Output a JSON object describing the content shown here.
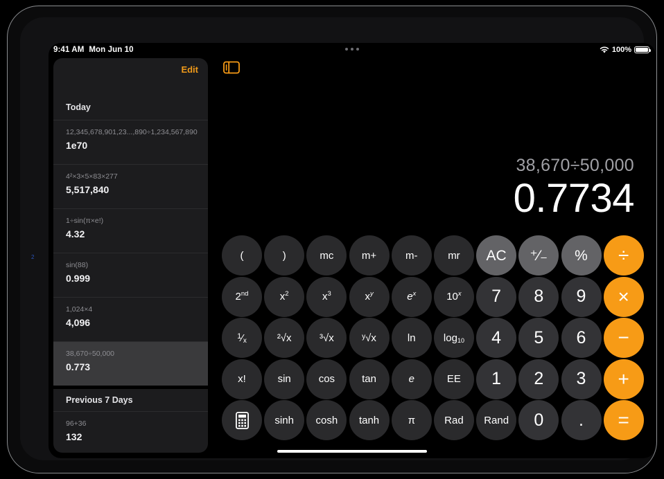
{
  "status_bar": {
    "time": "9:41 AM",
    "date": "Mon Jun 10",
    "wifi_icon": "wifi-icon",
    "battery_percent": "100%",
    "battery_icon": "battery-full-icon",
    "multitask_icon": "multitasking-dots-icon"
  },
  "sidebar": {
    "edit_label": "Edit",
    "sections": [
      {
        "title": "Today",
        "items": [
          {
            "expression": "12,345,678,901,23...,890÷1,234,567,890",
            "result": "1e70",
            "selected": false
          },
          {
            "expression": "4²×3×5×83×277",
            "result": "5,517,840",
            "selected": false
          },
          {
            "expression": "1÷sin(π×e!)",
            "result": "4.32",
            "selected": false
          },
          {
            "expression": "sin(88)",
            "result": "0.999",
            "selected": false
          },
          {
            "expression": "1,024×4",
            "result": "4,096",
            "selected": false
          },
          {
            "expression": "38,670÷50,000",
            "result": "0.773",
            "selected": true
          }
        ]
      },
      {
        "title": "Previous 7 Days",
        "items": [
          {
            "expression": "96+36",
            "result": "132",
            "selected": false
          }
        ]
      }
    ]
  },
  "main": {
    "sidebar_toggle_icon": "sidebar-toggle-icon",
    "display": {
      "expression": "38,670÷50,000",
      "result": "0.7734"
    }
  },
  "keypad": {
    "rows": [
      [
        {
          "label": "(",
          "name": "open-paren-key",
          "type": "fn"
        },
        {
          "label": ")",
          "name": "close-paren-key",
          "type": "fn"
        },
        {
          "label": "mc",
          "name": "memory-clear-key",
          "type": "fn"
        },
        {
          "label": "m+",
          "name": "memory-add-key",
          "type": "fn"
        },
        {
          "label": "m-",
          "name": "memory-subtract-key",
          "type": "fn"
        },
        {
          "label": "mr",
          "name": "memory-recall-key",
          "type": "fn"
        },
        {
          "label": "AC",
          "name": "all-clear-key",
          "type": "util"
        },
        {
          "label": "⁺⁄₋",
          "name": "plus-minus-key",
          "type": "util"
        },
        {
          "label": "%",
          "name": "percent-key",
          "type": "util"
        },
        {
          "label": "÷",
          "name": "divide-key",
          "type": "op"
        }
      ],
      [
        {
          "label": "2nd",
          "name": "second-function-key",
          "type": "fn",
          "sup": "nd",
          "base": "2"
        },
        {
          "label": "x²",
          "name": "x-squared-key",
          "type": "fn",
          "sup": "2",
          "base": "x"
        },
        {
          "label": "x³",
          "name": "x-cubed-key",
          "type": "fn",
          "sup": "3",
          "base": "x"
        },
        {
          "label": "xy",
          "name": "x-to-power-y-key",
          "type": "fn",
          "sup": "y",
          "base": "x"
        },
        {
          "label": "ex",
          "name": "e-to-power-x-key",
          "type": "fn",
          "sup": "x",
          "base": "e"
        },
        {
          "label": "10x",
          "name": "ten-to-power-x-key",
          "type": "fn",
          "sup": "x",
          "base": "10"
        },
        {
          "label": "7",
          "name": "digit-7-key",
          "type": "num"
        },
        {
          "label": "8",
          "name": "digit-8-key",
          "type": "num"
        },
        {
          "label": "9",
          "name": "digit-9-key",
          "type": "num"
        },
        {
          "label": "×",
          "name": "multiply-key",
          "type": "op"
        }
      ],
      [
        {
          "label": "1/x",
          "name": "reciprocal-key",
          "type": "fn"
        },
        {
          "label": "²√x",
          "name": "square-root-key",
          "type": "fn"
        },
        {
          "label": "³√x",
          "name": "cube-root-key",
          "type": "fn"
        },
        {
          "label": "ʸ√x",
          "name": "nth-root-key",
          "type": "fn"
        },
        {
          "label": "ln",
          "name": "natural-log-key",
          "type": "fn"
        },
        {
          "label": "log10",
          "name": "log-base-10-key",
          "type": "fn",
          "sub": "10",
          "base": "log"
        },
        {
          "label": "4",
          "name": "digit-4-key",
          "type": "num"
        },
        {
          "label": "5",
          "name": "digit-5-key",
          "type": "num"
        },
        {
          "label": "6",
          "name": "digit-6-key",
          "type": "num"
        },
        {
          "label": "−",
          "name": "subtract-key",
          "type": "op"
        }
      ],
      [
        {
          "label": "x!",
          "name": "factorial-key",
          "type": "fn"
        },
        {
          "label": "sin",
          "name": "sine-key",
          "type": "fn"
        },
        {
          "label": "cos",
          "name": "cosine-key",
          "type": "fn"
        },
        {
          "label": "tan",
          "name": "tangent-key",
          "type": "fn"
        },
        {
          "label": "e",
          "name": "euler-number-key",
          "type": "fn"
        },
        {
          "label": "EE",
          "name": "exponent-entry-key",
          "type": "fn"
        },
        {
          "label": "1",
          "name": "digit-1-key",
          "type": "num"
        },
        {
          "label": "2",
          "name": "digit-2-key",
          "type": "num"
        },
        {
          "label": "3",
          "name": "digit-3-key",
          "type": "num"
        },
        {
          "label": "+",
          "name": "add-key",
          "type": "op"
        }
      ],
      [
        {
          "label": "",
          "name": "calculator-mode-key",
          "type": "fn",
          "icon": "calculator-icon"
        },
        {
          "label": "sinh",
          "name": "hyperbolic-sine-key",
          "type": "fn"
        },
        {
          "label": "cosh",
          "name": "hyperbolic-cosine-key",
          "type": "fn"
        },
        {
          "label": "tanh",
          "name": "hyperbolic-tangent-key",
          "type": "fn"
        },
        {
          "label": "π",
          "name": "pi-key",
          "type": "fn"
        },
        {
          "label": "Rad",
          "name": "radians-key",
          "type": "fn"
        },
        {
          "label": "Rand",
          "name": "random-key",
          "type": "fn"
        },
        {
          "label": "0",
          "name": "digit-0-key",
          "type": "num"
        },
        {
          "label": ".",
          "name": "decimal-point-key",
          "type": "num"
        },
        {
          "label": "=",
          "name": "equals-key",
          "type": "op"
        }
      ]
    ]
  },
  "colors": {
    "accent_orange": "#f79b16",
    "edit_orange": "#f09a1a",
    "sidebar_bg": "#1c1c1e",
    "selected_row": "#3a3a3c",
    "function_key": "#2a2a2c",
    "number_key": "#333336",
    "utility_key": "#636366",
    "screen_bg": "#000000"
  },
  "edge_marker": "2"
}
